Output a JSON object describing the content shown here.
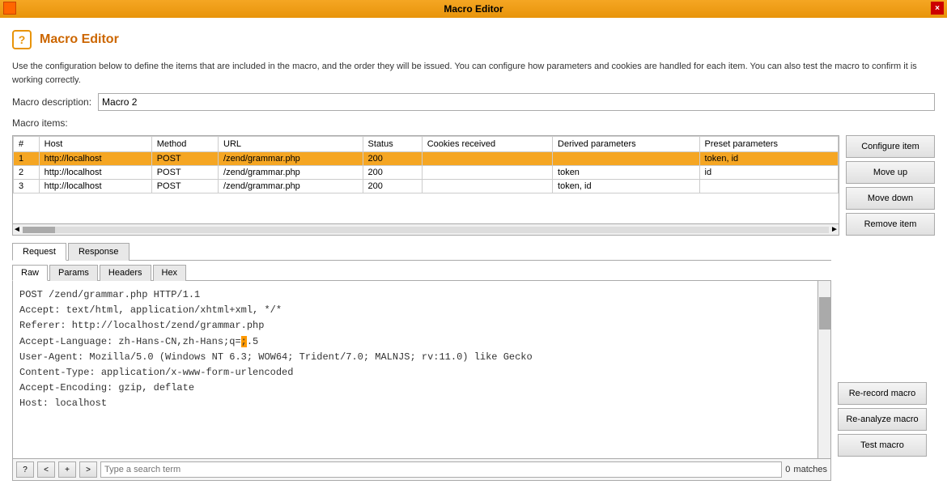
{
  "titleBar": {
    "title": "Macro Editor",
    "closeLabel": "×"
  },
  "header": {
    "title": "Macro Editor",
    "iconLabel": "?"
  },
  "description": {
    "text": "Use the configuration below to define the items that are included in the macro, and the order they will be issued. You can configure how parameters and cookies are handled for each item. You can also test the macro to confirm it is working correctly."
  },
  "form": {
    "macroDescriptionLabel": "Macro description:",
    "macroDescriptionValue": "Macro 2",
    "macroItemsLabel": "Macro items:"
  },
  "table": {
    "columns": [
      "#",
      "Host",
      "Method",
      "URL",
      "Status",
      "Cookies received",
      "Derived parameters",
      "Preset parameters"
    ],
    "rows": [
      {
        "num": "1",
        "host": "http://localhost",
        "method": "POST",
        "url": "/zend/grammar.php",
        "status": "200",
        "cookies": "",
        "derived": "",
        "preset": "token, id",
        "selected": true
      },
      {
        "num": "2",
        "host": "http://localhost",
        "method": "POST",
        "url": "/zend/grammar.php",
        "status": "200",
        "cookies": "",
        "derived": "token",
        "preset": "id",
        "selected": false
      },
      {
        "num": "3",
        "host": "http://localhost",
        "method": "POST",
        "url": "/zend/grammar.php",
        "status": "200",
        "cookies": "",
        "derived": "token, id",
        "preset": "",
        "selected": false
      }
    ]
  },
  "sideButtons": {
    "configureItem": "Configure item",
    "moveUp": "Move up",
    "moveDown": "Move down",
    "removeItem": "Remove item"
  },
  "tabs": {
    "request": "Request",
    "response": "Response"
  },
  "innerTabs": {
    "raw": "Raw",
    "params": "Params",
    "headers": "Headers",
    "hex": "Hex"
  },
  "requestContent": [
    "POST /zend/grammar.php HTTP/1.1",
    "Accept: text/html, application/xhtml+xml, */*",
    "Referer: http://localhost/zend/grammar.php",
    "Accept-Language: zh-Hans-CN,zh-Hans;q=0.5",
    "User-Agent: Mozilla/5.0 (Windows NT 6.3; WOW64; Trident/7.0; MALNJS; rv:11.0) like Gecko",
    "Content-Type: application/x-www-form-urlencoded",
    "Accept-Encoding: gzip, deflate",
    "Host: localhost"
  ],
  "bottomBar": {
    "questionBtnLabel": "?",
    "prevBtnLabel": "<",
    "addBtnLabel": "+",
    "nextBtnLabel": ">",
    "searchPlaceholder": "Type a search term",
    "matchesCount": "0",
    "matchesLabel": "matches"
  },
  "rightBottomButtons": {
    "reRecord": "Re-record macro",
    "reAnalyze": "Re-analyze macro",
    "test": "Test macro"
  }
}
